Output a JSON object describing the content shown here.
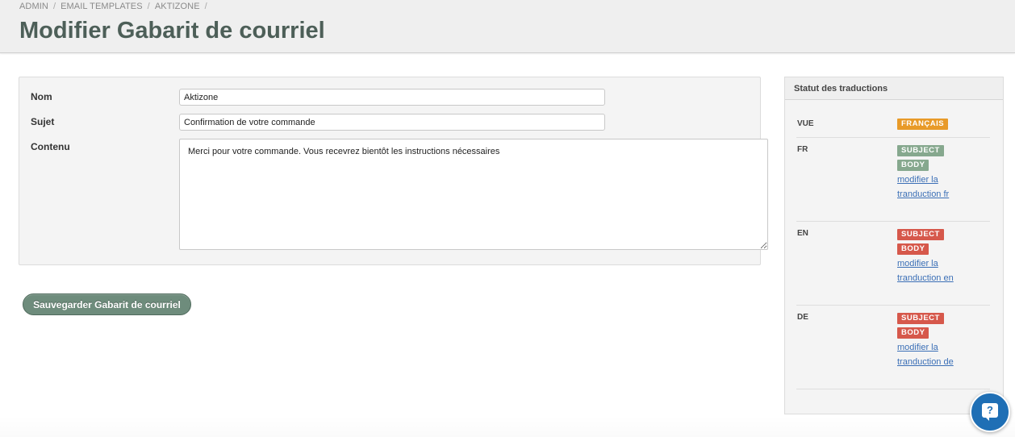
{
  "breadcrumb": {
    "items": [
      "ADMIN",
      "EMAIL TEMPLATES",
      "AKTIZONE"
    ],
    "separator": "/"
  },
  "page": {
    "title": "Modifier Gabarit de courriel"
  },
  "form": {
    "name_label": "Nom",
    "name_value": "Aktizone",
    "subject_label": "Sujet",
    "subject_value": "Confirmation de votre commande",
    "content_label": "Contenu",
    "content_value": "Merci pour votre commande. Vous recevrez bientôt les instructions nécessaires",
    "save_label": "Sauvegarder Gabarit de courriel"
  },
  "translations": {
    "title": "Statut des traductions",
    "view_label": "VUE",
    "view_badge": "FRANÇAIS",
    "rows": [
      {
        "code": "FR",
        "subject": "SUBJECT",
        "body": "BODY",
        "link_line1": "modifier la",
        "link_line2": "tranduction fr",
        "status": "complete"
      },
      {
        "code": "EN",
        "subject": "SUBJECT",
        "body": "BODY",
        "link_line1": "modifier la",
        "link_line2": "tranduction en",
        "status": "missing"
      },
      {
        "code": "DE",
        "subject": "SUBJECT",
        "body": "BODY",
        "link_line1": "modifier la",
        "link_line2": "tranduction de",
        "status": "missing"
      }
    ]
  },
  "colors": {
    "title": "#4d5f58",
    "save_button": "#6e8c7c",
    "badge_view": "#e89a28",
    "badge_complete": "#86a88e",
    "badge_missing": "#d6584b",
    "link": "#3b6fb6",
    "help_button": "#1f6fb5"
  },
  "icons": {
    "help": "help-chat-icon"
  },
  "help_glyph": "?"
}
